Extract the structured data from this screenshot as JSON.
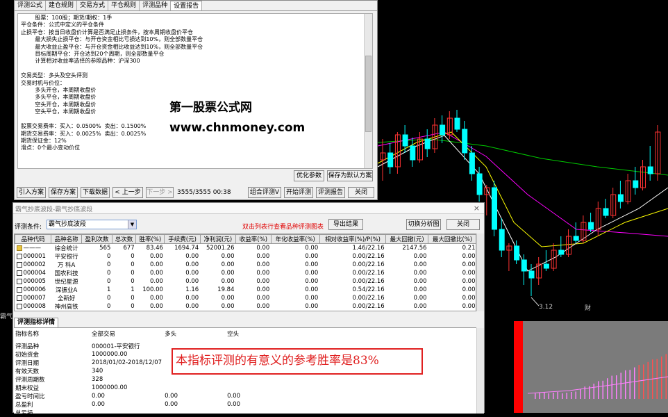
{
  "colors": {
    "bull": "#ff3232",
    "bear": "#00ffff",
    "ma1": "#ffffff",
    "ma2": "#ffff00",
    "ma3": "#ff00ff",
    "ma4": "#00cc00",
    "highlight": "#e02020"
  },
  "top_window": {
    "tabs": [
      "评测公式",
      "建仓规则",
      "交易方式",
      "平仓规则",
      "评测品种",
      "设置报告"
    ],
    "active_tab": 5,
    "report_lines": [
      "        股票：100股；期货/期权：1手",
      "平仓条件：公式中定义的平仓条件",
      "止损平仓：按当日收盘价计算是否满足止损条件，按本周期收盘价平仓",
      "        最大损失止损平仓：与开仓资金相比亏损达到10%，则全部数量平仓",
      "        最大收益止盈平仓：与开仓资金相比收益达到10%，则全部数量平仓",
      "        目标周期平仓：开仓达到20个周期，则全部数量平仓",
      "        计算相对收益率选择的参照品种：沪深300",
      "",
      "交易类型：多头及空头评测",
      "交易时机与价位：",
      "        多头开仓，本周期收盘价",
      "        多头平仓，本周期收盘价",
      "        空头开仓，本周期收盘价",
      "        空头平仓，本周期收盘价",
      "",
      "股票交易费率：买入：0.0500%  卖出：0.1500%",
      "期货交易费率：买入：0.0025%  卖出：0.0025%",
      "期货保证金：12%",
      "滑点：0个最小变动价位"
    ],
    "optimize_button": "优化参数",
    "save_default_button": "保存为默认方案",
    "import_button": "引入方案",
    "save_button": "保存方案",
    "download_button": "下载数据",
    "prev_button": "< 上一步",
    "next_button": "下一步 >",
    "progress_text": "3555/3555 00:38",
    "combo_button": "组合评测V",
    "start_button": "开始评测",
    "report_button": "评测报告",
    "close_button": "关闭"
  },
  "watermark": {
    "line1": "第一股票公式网",
    "line2": "www.chnmoney.com"
  },
  "chart": {
    "min_label": "3.12",
    "stub_label": "霸气抄",
    "right_label": "财",
    "candles": [
      [
        4.1,
        4.25,
        3.95,
        4.15
      ],
      [
        4.15,
        4.22,
        4.0,
        4.05
      ],
      [
        4.05,
        4.3,
        4.0,
        4.28
      ],
      [
        4.28,
        4.35,
        4.15,
        4.2
      ],
      [
        4.2,
        4.26,
        4.05,
        4.1
      ],
      [
        4.1,
        4.3,
        4.08,
        4.25
      ],
      [
        4.25,
        4.32,
        4.12,
        4.18
      ],
      [
        4.18,
        4.4,
        4.15,
        4.35
      ],
      [
        4.35,
        4.42,
        4.22,
        4.28
      ],
      [
        4.28,
        4.45,
        4.25,
        4.4
      ],
      [
        4.4,
        4.46,
        4.3,
        4.32
      ],
      [
        4.32,
        4.38,
        4.1,
        4.15
      ],
      [
        4.15,
        4.2,
        3.95,
        4.0
      ],
      [
        4.0,
        4.05,
        3.8,
        3.85
      ],
      [
        3.85,
        3.92,
        3.7,
        3.9
      ],
      [
        3.9,
        3.95,
        3.55,
        3.6
      ],
      [
        3.6,
        3.68,
        3.4,
        3.45
      ],
      [
        3.45,
        3.5,
        3.3,
        3.48
      ],
      [
        3.48,
        3.52,
        3.35,
        3.38
      ],
      [
        3.38,
        3.42,
        3.2,
        3.3
      ],
      [
        3.3,
        3.35,
        3.12,
        3.25
      ],
      [
        3.25,
        3.4,
        3.2,
        3.35
      ],
      [
        3.35,
        3.45,
        3.3,
        3.32
      ],
      [
        3.32,
        3.5,
        3.3,
        3.45
      ],
      [
        3.45,
        3.55,
        3.4,
        3.42
      ],
      [
        3.42,
        3.6,
        3.4,
        3.55
      ],
      [
        3.55,
        3.65,
        3.5,
        3.52
      ],
      [
        3.52,
        3.7,
        3.5,
        3.65
      ],
      [
        3.65,
        3.72,
        3.58,
        3.6
      ],
      [
        3.6,
        3.8,
        3.55,
        3.75
      ],
      [
        3.75,
        3.82,
        3.68,
        3.7
      ],
      [
        3.7,
        3.9,
        3.68,
        3.85
      ],
      [
        3.85,
        3.95,
        3.75,
        3.8
      ],
      [
        3.8,
        4.0,
        3.78,
        3.95
      ],
      [
        3.95,
        4.05,
        3.85,
        3.9
      ],
      [
        3.9,
        4.1,
        3.88,
        4.05
      ],
      [
        4.05,
        4.2,
        3.95,
        4.0
      ],
      [
        4.0,
        4.35,
        3.95,
        4.3
      ]
    ]
  },
  "bottom_window": {
    "title": "霸气抄底波段-霸气抄底波段",
    "condition_label": "评测条件:",
    "condition_value": "霸气抄底波段",
    "hint": "双击列表行查看品种评测图表",
    "export_button": "导出结果",
    "switch_button": "切换分析图",
    "close_button": "关闭",
    "close_x": "×",
    "columns": [
      "品种代码",
      "品种名称",
      "盈利次数",
      "总次数",
      "胜率(%)",
      "手续费(元)",
      "净利润(元)",
      "收益率(%)",
      "年化收益率(%)",
      "相对收益率(%)/P(%)",
      "最大回撤(元)",
      "最大回撤比(%)"
    ],
    "rows": [
      [
        "———",
        "综合统计",
        "565",
        "677",
        "83.46",
        "1694.74",
        "52001.26",
        "0.00",
        "0.00",
        "1.46/22.16",
        "2147.56",
        "0.21"
      ],
      [
        "000001",
        "平安银行",
        "0",
        "0",
        "0.00",
        "0.00",
        "0.00",
        "0.00",
        "0.00",
        "0.00/22.16",
        "0.00",
        "0.00"
      ],
      [
        "000002",
        "万  科A",
        "0",
        "0",
        "0.00",
        "0.00",
        "0.00",
        "0.00",
        "0.00",
        "0.00/22.16",
        "0.00",
        "0.00"
      ],
      [
        "000004",
        "国农科技",
        "0",
        "0",
        "0.00",
        "0.00",
        "0.00",
        "0.00",
        "0.00",
        "0.00/22.16",
        "0.00",
        "0.00"
      ],
      [
        "000005",
        "世纪星源",
        "0",
        "0",
        "0.00",
        "0.00",
        "0.00",
        "0.00",
        "0.00",
        "0.00/22.16",
        "0.00",
        "0.00"
      ],
      [
        "000006",
        "深振业A",
        "1",
        "1",
        "100.00",
        "1.16",
        "19.84",
        "0.00",
        "0.00",
        "0.54/22.16",
        "0.00",
        "0.00"
      ],
      [
        "000007",
        "全新好",
        "0",
        "0",
        "0.00",
        "0.00",
        "0.00",
        "0.00",
        "0.00",
        "0.00/22.16",
        "0.00",
        "0.00"
      ],
      [
        "000008",
        "神州高铁",
        "0",
        "0",
        "0.00",
        "0.00",
        "0.00",
        "0.00",
        "0.00",
        "0.00/22.16",
        "0.00",
        "0.00"
      ]
    ],
    "detail_tab": "评测指标详情",
    "detail_headers": [
      "指标名称",
      "全部交易",
      "多头",
      "空头"
    ],
    "detail_rows": [
      [
        "评测品种",
        "000001-平安银行",
        "",
        ""
      ],
      [
        "初始资金",
        "1000000.00",
        "",
        ""
      ],
      [
        "评测日期",
        "2018/01/02-2018/12/07",
        "",
        ""
      ],
      [
        "有效天数",
        "340",
        "",
        ""
      ],
      [
        "评测周期数",
        "328",
        "",
        ""
      ],
      [
        "期末权益",
        "1000000.00",
        "",
        ""
      ],
      [
        "盈亏时间比",
        "0.00",
        "0.00",
        "0.00"
      ],
      [
        "总盈利",
        "0.00",
        "0.00",
        "0.00"
      ],
      [
        "总亏损",
        "",
        "",
        ""
      ]
    ],
    "annotation": "本指标评测的有意义的参考胜率是83%"
  }
}
